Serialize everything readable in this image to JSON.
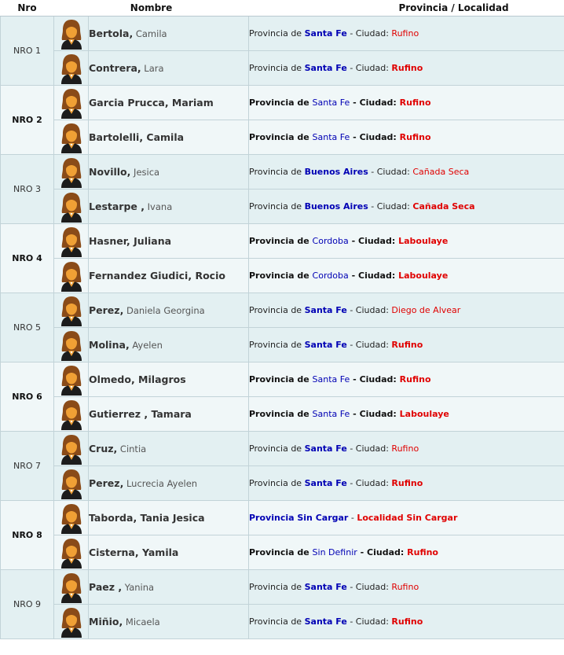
{
  "headers": {
    "nro": "Nro",
    "nombre": "Nombre",
    "provincia": "Provincia / Localidad"
  },
  "labels": {
    "provincia_de": "Provincia de",
    "sep": "-",
    "ciudad": "Ciudad:"
  },
  "colors": {
    "province": "#0000b4",
    "city": "#e00000",
    "row_dark": "#e3f0f2",
    "row_light": "#f0f7f8"
  },
  "avatar_icon": "female-user-icon",
  "groups": [
    {
      "nro": "NRO 1",
      "bold": false,
      "members": [
        {
          "last": "Bertola",
          "comma": ",",
          "first": " Camila",
          "style": "mixed",
          "prov": "Santa Fe",
          "city": "Rufino",
          "prov_style": "light"
        },
        {
          "last": "Contrera",
          "comma": ",",
          "first": " Lara",
          "style": "mixed",
          "prov": "Santa Fe",
          "city": "Rufino",
          "prov_style": "lightcitybold"
        }
      ]
    },
    {
      "nro": "NRO 2",
      "bold": true,
      "members": [
        {
          "last": "Garcia Prucca",
          "comma": ",",
          "first": " Mariam",
          "style": "bold",
          "prov": "Santa Fe",
          "city": "Rufino",
          "prov_style": "bold"
        },
        {
          "last": "Bartolelli",
          "comma": ",",
          "first": " Camila",
          "style": "bold",
          "prov": "Santa Fe",
          "city": "Rufino",
          "prov_style": "bold"
        }
      ]
    },
    {
      "nro": "NRO 3",
      "bold": false,
      "members": [
        {
          "last": "Novillo",
          "comma": ",",
          "first": " Jesica",
          "style": "mixed",
          "prov": "Buenos Aires",
          "city": "Cañada Seca",
          "prov_style": "light"
        },
        {
          "last": "Lestarpe ",
          "comma": ",",
          "first": " Ivana",
          "style": "mixed",
          "prov": "Buenos Aires",
          "city": "Cañada Seca",
          "prov_style": "lightcitybold"
        }
      ]
    },
    {
      "nro": "NRO 4",
      "bold": true,
      "members": [
        {
          "last": "Hasner",
          "comma": ",",
          "first": " Juliana",
          "style": "bold",
          "prov": "Cordoba",
          "city": "Laboulaye",
          "prov_style": "bold"
        },
        {
          "last": "Fernandez Giudici",
          "comma": ",",
          "first": " Rocio",
          "style": "bold",
          "prov": "Cordoba",
          "city": "Laboulaye",
          "prov_style": "bold"
        }
      ]
    },
    {
      "nro": "NRO 5",
      "bold": false,
      "members": [
        {
          "last": "Perez",
          "comma": ",",
          "first": " Daniela Georgina",
          "style": "mixed",
          "prov": "Santa Fe",
          "city": "Diego de Alvear",
          "prov_style": "light"
        },
        {
          "last": "Molina",
          "comma": ",",
          "first": " Ayelen",
          "style": "mixed",
          "prov": "Santa Fe",
          "city": "Rufino",
          "prov_style": "lightcitybold"
        }
      ]
    },
    {
      "nro": "NRO 6",
      "bold": true,
      "members": [
        {
          "last": "Olmedo",
          "comma": ",",
          "first": " Milagros",
          "style": "bold",
          "prov": "Santa Fe",
          "city": "Rufino",
          "prov_style": "bold"
        },
        {
          "last": "Gutierrez ",
          "comma": ",",
          "first": " Tamara",
          "style": "bold",
          "prov": "Santa Fe",
          "city": "Laboulaye",
          "prov_style": "bold"
        }
      ]
    },
    {
      "nro": "NRO 7",
      "bold": false,
      "members": [
        {
          "last": "Cruz",
          "comma": ",",
          "first": " Cintia",
          "style": "mixed",
          "prov": "Santa Fe",
          "city": "Rufino",
          "prov_style": "light"
        },
        {
          "last": "Perez",
          "comma": ",",
          "first": " Lucrecia Ayelen",
          "style": "mixed",
          "prov": "Santa Fe",
          "city": "Rufino",
          "prov_style": "lightcitybold"
        }
      ]
    },
    {
      "nro": "NRO 8",
      "bold": true,
      "members": [
        {
          "last": "Taborda",
          "comma": ",",
          "first": " Tania Jesica",
          "style": "bold",
          "prov": "Provincia Sin Cargar",
          "city": "Localidad Sin Cargar",
          "prov_style": "sincargar"
        },
        {
          "last": "Cisterna",
          "comma": ",",
          "first": " Yamila",
          "style": "bold",
          "prov": "Sin Definir",
          "city": "Rufino",
          "prov_style": "bold"
        }
      ]
    },
    {
      "nro": "NRO 9",
      "bold": false,
      "members": [
        {
          "last": "Paez ",
          "comma": ",",
          "first": " Yanina",
          "style": "mixed",
          "prov": "Santa Fe",
          "city": "Rufino",
          "prov_style": "light"
        },
        {
          "last": "Miñio",
          "comma": ",",
          "first": " Micaela",
          "style": "mixed",
          "prov": "Santa Fe",
          "city": "Rufino",
          "prov_style": "lightcitybold"
        }
      ]
    }
  ]
}
